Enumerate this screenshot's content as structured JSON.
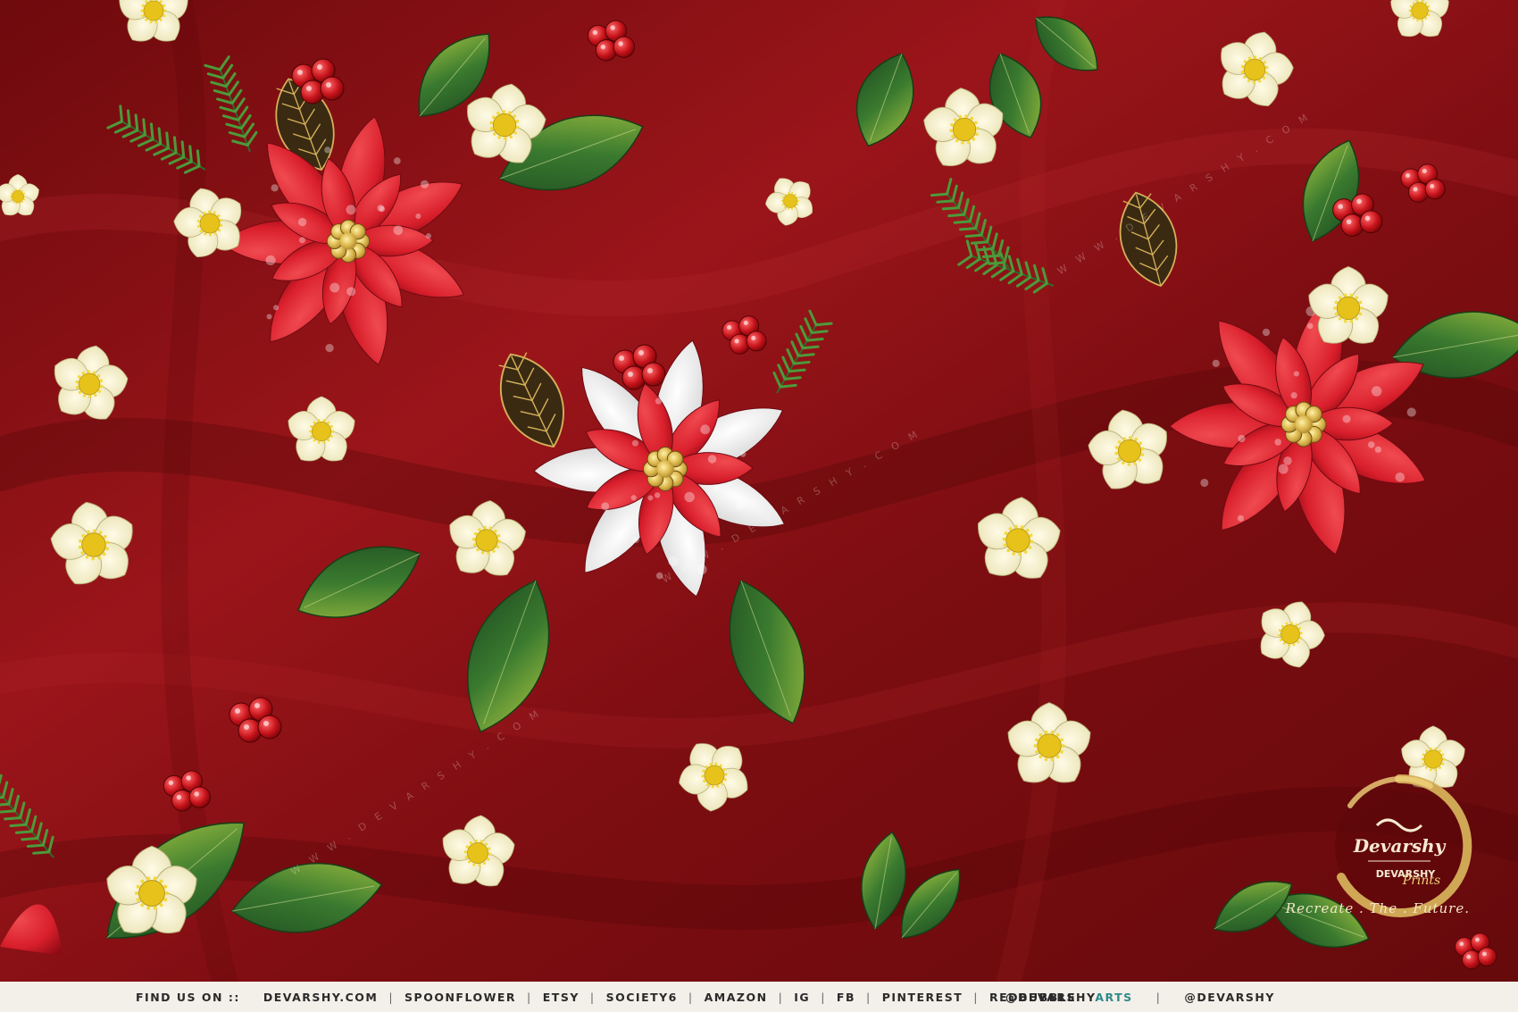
{
  "colors": {
    "fabric": "#8e1216",
    "fabric_dark": "#5c070a",
    "poinsettia_red": "#d81e2b",
    "leaf_green": "#2e6b2c",
    "cream_flower": "#f7f2cf",
    "flower_center": "#e6c21a",
    "gold": "#c9a44c",
    "teal_accent": "#2d8a8a"
  },
  "watermarks": [
    "W W W . D E V A R S H Y . C O M"
  ],
  "footer": {
    "find_label": "FIND US ON ::",
    "links": [
      "DEVARSHY.COM",
      "SPOONFLOWER",
      "ETSY",
      "SOCIETY6",
      "AMAZON",
      "IG",
      "FB",
      "PINTEREST",
      "REDBUBBLE"
    ],
    "handle_prefix": "@DEVARSHY",
    "handle_suffix": "ARTS",
    "handle_2": "@DEVARSHY"
  },
  "logo": {
    "brand": "Devarshy",
    "sub_brand": "DEVARSHY",
    "script": "Prints"
  },
  "tagline": "Recreate . The . Future."
}
